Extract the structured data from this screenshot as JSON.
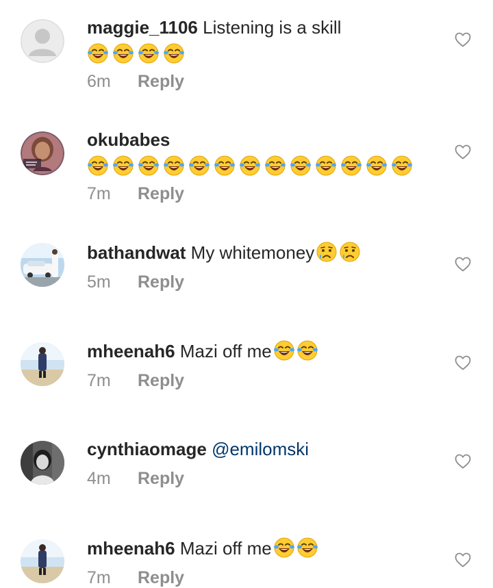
{
  "comments": [
    {
      "username": "maggie_1106",
      "text": " Listening is a skill",
      "emoji_count": 4,
      "emoji_kind": "face-with-tears-of-joy",
      "time": "6m",
      "reply": "Reply"
    },
    {
      "username": "okubabes",
      "text": "",
      "emoji_count": 13,
      "emoji_kind": "face-with-tears-of-joy",
      "time": "7m",
      "reply": "Reply"
    },
    {
      "username": "bathandwat",
      "text": " My whitemoney",
      "inline_emoji_count": 2,
      "emoji_kind": "crying-face",
      "time": "5m",
      "reply": "Reply"
    },
    {
      "username": "mheenah6",
      "text": " Mazi off me",
      "inline_emoji_count": 2,
      "emoji_kind": "face-with-tears-of-joy",
      "time": "7m",
      "reply": "Reply"
    },
    {
      "username": "cynthiaomage",
      "text": " ",
      "mention": "@emilomski",
      "time": "4m",
      "reply": "Reply"
    },
    {
      "username": "mheenah6",
      "text": " Mazi off me",
      "inline_emoji_count": 2,
      "emoji_kind": "face-with-tears-of-joy",
      "time": "7m",
      "reply": "Reply"
    }
  ],
  "colors": {
    "username": "#262626",
    "meta": "#8e8e8e",
    "mention": "#00376b",
    "heart_stroke": "#8e8e8e"
  },
  "icons": {
    "like": "heart-outline-icon",
    "avatar_default": "default-avatar-icon"
  }
}
